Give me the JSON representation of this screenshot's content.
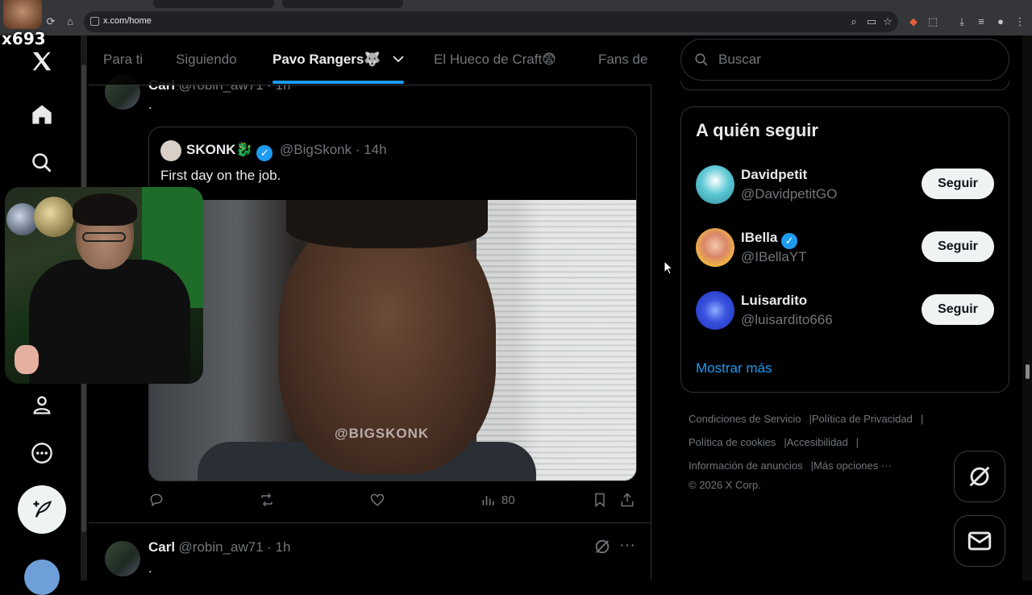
{
  "browser": {
    "url": "x.com/home"
  },
  "stream_overlay": {
    "label": "x693"
  },
  "tabs": [
    {
      "label": "Para ti"
    },
    {
      "label": "Siguiendo"
    },
    {
      "label": "Pavo Rangers🐺"
    },
    {
      "label": "El Hueco de Craft😨"
    },
    {
      "label": "Fans de"
    }
  ],
  "tweet1": {
    "name": "Carl",
    "handle": "@robin_aw71",
    "time": "· 1h",
    "text": ".",
    "quote": {
      "name": "SKONK🐉",
      "handle": "@BigSkonk",
      "time": "· 14h",
      "text": "First day on the job.",
      "watermark": "@BIGSKONK"
    },
    "views": "80"
  },
  "tweet2": {
    "name": "Carl",
    "handle": "@robin_aw71",
    "time": "· 1h",
    "text": "."
  },
  "search": {
    "placeholder": "Buscar"
  },
  "who_to_follow": {
    "title": "A quién seguir",
    "follow_label": "Seguir",
    "users": [
      {
        "name": "Davidpetit",
        "handle": "@DavidpetitGO",
        "verified": false,
        "avatar_color": "#5ec9d6"
      },
      {
        "name": "IBella",
        "handle": "@IBellaYT",
        "verified": true,
        "avatar_color": "#f4b93e"
      },
      {
        "name": "Luisardito",
        "handle": "@luisardito666",
        "verified": false,
        "avatar_color": "#1c2fb8"
      }
    ],
    "show_more": "Mostrar más"
  },
  "footer": {
    "links": [
      "Condiciones de Servicio",
      "Política de Privacidad",
      "Política de cookies",
      "Accesibilidad",
      "Información de anuncios",
      "Más opciones ···"
    ],
    "copyright": "© 2026 X Corp."
  },
  "colors": {
    "accent": "#1d9bf0",
    "background": "#000000",
    "border": "#2f3336",
    "muted_text": "#71767b"
  }
}
